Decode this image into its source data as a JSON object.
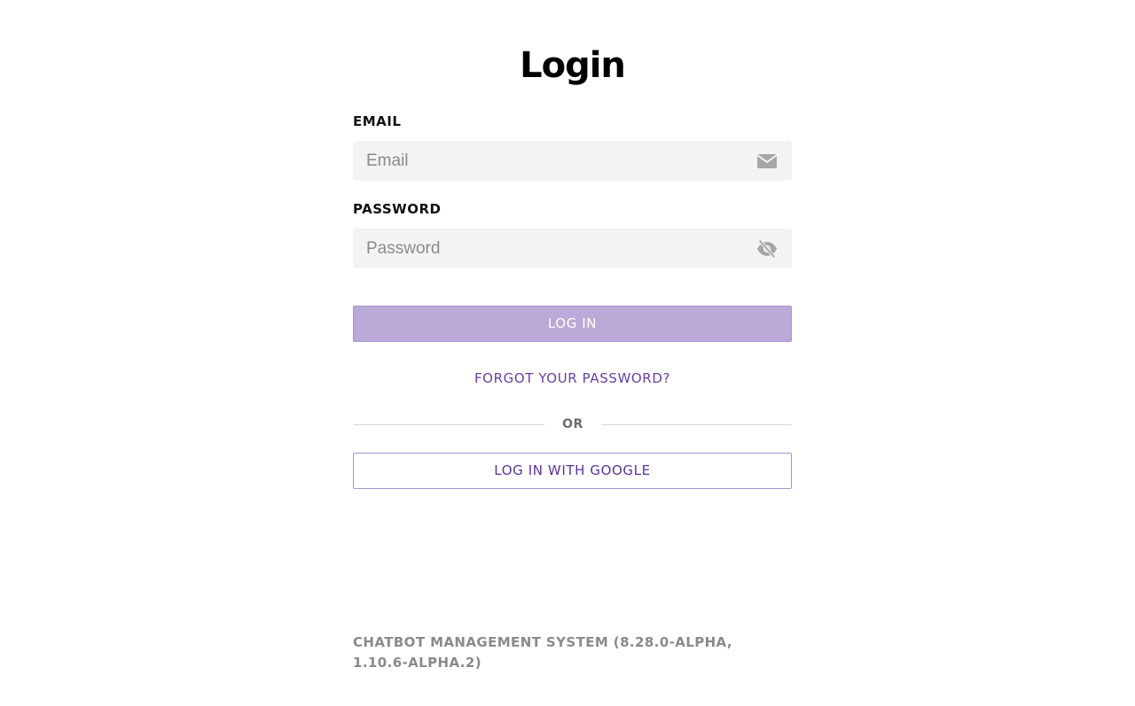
{
  "login": {
    "title": "Login",
    "email_label": "EMAIL",
    "email_placeholder": "Email",
    "email_value": "",
    "email_icon": "envelope-icon",
    "password_label": "PASSWORD",
    "password_placeholder": "Password",
    "password_value": "",
    "password_icon": "eye-slash-icon",
    "login_button": "LOG IN",
    "forgot_link": "FORGOT YOUR PASSWORD?",
    "divider_text": "OR",
    "google_button": "LOG IN WITH GOOGLE"
  },
  "footer": {
    "version_text": "CHATBOT MANAGEMENT SYSTEM (8.28.0-ALPHA, 1.10.6-ALPHA.2)"
  },
  "colors": {
    "accent": "#6a3fa0",
    "login_button_bg": "#bba9d7",
    "field_bg": "#f3f3f3",
    "footer_text": "#8a8a8a"
  }
}
